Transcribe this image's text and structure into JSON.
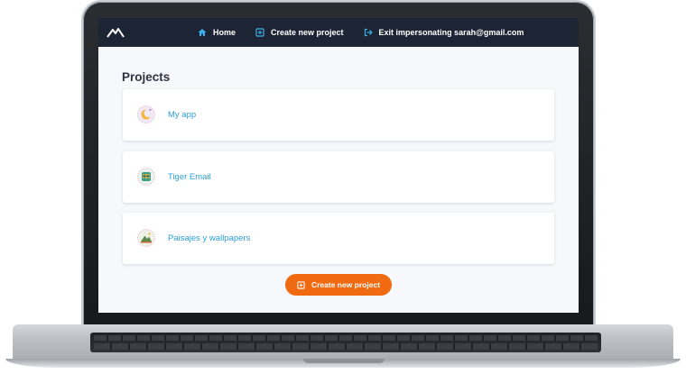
{
  "nav": {
    "links": [
      {
        "label": "Home",
        "icon": "home-icon"
      },
      {
        "label": "Create new project",
        "icon": "plus-square-icon"
      },
      {
        "label": "Exit impersonating sarah@gmail.com",
        "icon": "sign-out-icon"
      }
    ]
  },
  "main": {
    "heading": "Projects",
    "projects": [
      {
        "name": "My app",
        "icon": "moon-avatar-icon"
      },
      {
        "name": "Tiger Email",
        "icon": "tiger-avatar-icon"
      },
      {
        "name": "Paisajes y wallpapers",
        "icon": "mountain-avatar-icon"
      }
    ],
    "create_button": "Create new project"
  },
  "colors": {
    "nav_bg": "#1d2433",
    "accent": "#f06a12",
    "link": "#2a9fd8",
    "page_bg": "#f6f8fb"
  }
}
